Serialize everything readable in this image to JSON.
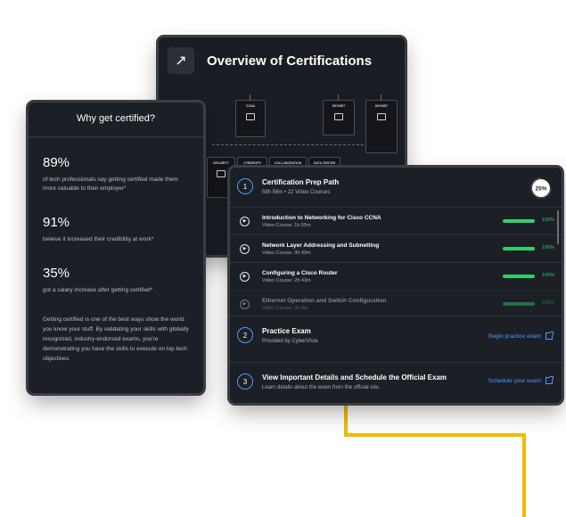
{
  "overview": {
    "title": "Overview of Certifications",
    "boxes": [
      {
        "label": "CCNA"
      },
      {
        "label": "DEVNET"
      },
      {
        "label": "DEVNET"
      },
      {
        "label": "SECURITY"
      },
      {
        "label": "CYBEROPS"
      },
      {
        "label": "COLLABORATION"
      },
      {
        "label": "DATA CENTER"
      }
    ]
  },
  "why": {
    "title": "Why get certified?",
    "stats": [
      {
        "value": "89%",
        "text": "of tech professionals say getting certified made them more valuable to their employer*"
      },
      {
        "value": "91%",
        "text": "believe it increased their credibility at work*"
      },
      {
        "value": "35%",
        "text": "got a salary increase after getting certified*"
      }
    ],
    "paragraph": "Getting certified is one of the best ways show the world you know your stuff. By validating your skills with globally recognized, industry-endorsed exams, you're demonstrating you have the skills to execute on top tech objectives."
  },
  "prep": {
    "step1": {
      "num": "1",
      "title": "Certification Prep Path",
      "sub": "58h 58m  •  22 Video Courses",
      "progress_label": "25%",
      "progress": 0.25
    },
    "courses": [
      {
        "title": "Introduction to Networking for Cisco CCNA",
        "sub": "Video Course: 1h 55m",
        "pct": "100%"
      },
      {
        "title": "Network Layer Addressing and Subnetting",
        "sub": "Video Course: 3h 49m",
        "pct": "100%"
      },
      {
        "title": "Configuring a Cisco Router",
        "sub": "Video Course: 2h 43m",
        "pct": "100%"
      },
      {
        "title": "Ethernet Operation and Switch Configuration",
        "sub": "Video Course: 3h 4m",
        "pct": "100%"
      }
    ],
    "step2": {
      "num": "2",
      "title": "Practice Exam",
      "sub": "Provided by CyberVista",
      "link": "Begin practice exam"
    },
    "step3": {
      "num": "3",
      "title": "View Important Details and Schedule the Official Exam",
      "sub": "Learn details about the exam from the official site.",
      "link": "Schedule your exam"
    }
  },
  "colors": {
    "accent": "#4a9eff",
    "success": "#2fd16a",
    "highlight": "#f5b800"
  },
  "icons": [
    "expand-icon",
    "play-icon",
    "external-link-icon"
  ]
}
